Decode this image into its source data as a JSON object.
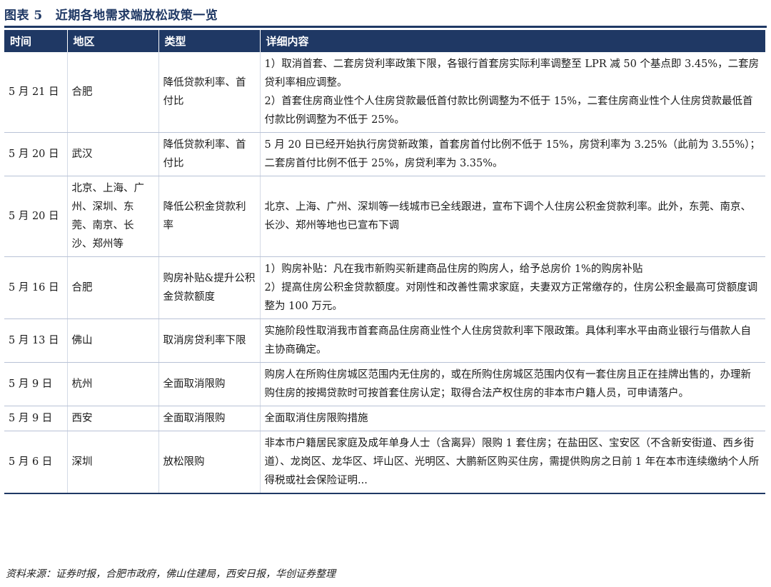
{
  "figure": {
    "label": "图表 5",
    "title": "近期各地需求端放松政策一览"
  },
  "table": {
    "headers": [
      "时间",
      "地区",
      "类型",
      "详细内容"
    ],
    "rows": [
      {
        "date": "5 月 21 日",
        "region": "合肥",
        "type": "降低贷款利率、首付比",
        "details": [
          "1）取消首套、二套房贷利率政策下限，各银行首套房实际利率调整至 LPR 减 50 个基点即 3.45%，二套房贷利率相应调整。",
          "2）首套住房商业性个人住房贷款最低首付款比例调整为不低于 15%，二套住房商业性个人住房贷款最低首付款比例调整为不低于 25%。"
        ]
      },
      {
        "date": "5 月 20 日",
        "region": "武汉",
        "type": "降低贷款利率、首付比",
        "details": [
          "5 月 20 日已经开始执行房贷新政策，首套房首付比例不低于 15%，房贷利率为 3.25%（此前为 3.55%）；二套房首付比例不低于 25%，房贷利率为 3.35%。"
        ]
      },
      {
        "date": "5 月 20 日",
        "region": "北京、上海、广州、深圳、东莞、南京、长沙、郑州等",
        "type": "降低公积金贷款利率",
        "details": [
          "北京、上海、广州、深圳等一线城市已全线跟进，宣布下调个人住房公积金贷款利率。此外，东莞、南京、长沙、郑州等地也已宣布下调"
        ]
      },
      {
        "date": "5 月 16 日",
        "region": "合肥",
        "type": "购房补贴&提升公积金贷款额度",
        "details": [
          "1）购房补贴：凡在我市新购买新建商品住房的购房人，给予总房价 1%的购房补贴",
          "2）提高住房公积金贷款额度。对刚性和改善性需求家庭，夫妻双方正常缴存的，住房公积金最高可贷额度调整为 100 万元。"
        ]
      },
      {
        "date": "5 月 13 日",
        "region": "佛山",
        "type": "取消房贷利率下限",
        "details": [
          "实施阶段性取消我市首套商品住房商业性个人住房贷款利率下限政策。具体利率水平由商业银行与借款人自主协商确定。"
        ]
      },
      {
        "date": "5 月 9 日",
        "region": "杭州",
        "type": "全面取消限购",
        "details": [
          "购房人在所购住房城区范围内无住房的，或在所购住房城区范围内仅有一套住房且正在挂牌出售的，办理新购住房的按揭贷款时可按首套住房认定；取得合法产权住房的非本市户籍人员，可申请落户。"
        ]
      },
      {
        "date": "5 月 9 日",
        "region": "西安",
        "type": "全面取消限购",
        "details": [
          "全面取消住房限购措施"
        ]
      },
      {
        "date": "5 月 6 日",
        "region": "深圳",
        "type": "放松限购",
        "details": [
          "非本市户籍居民家庭及成年单身人士（含离异）限购 1 套住房；在盐田区、宝安区（不含新安街道、西乡街道）、龙岗区、龙华区、坪山区、光明区、大鹏新区购买住房，需提供购房之日前 1 年在本市连续缴纳个人所得税或社会保险证明..."
        ]
      }
    ]
  },
  "source": "资料来源：证券时报，合肥市政府，佛山住建局，西安日报，华创证券整理"
}
